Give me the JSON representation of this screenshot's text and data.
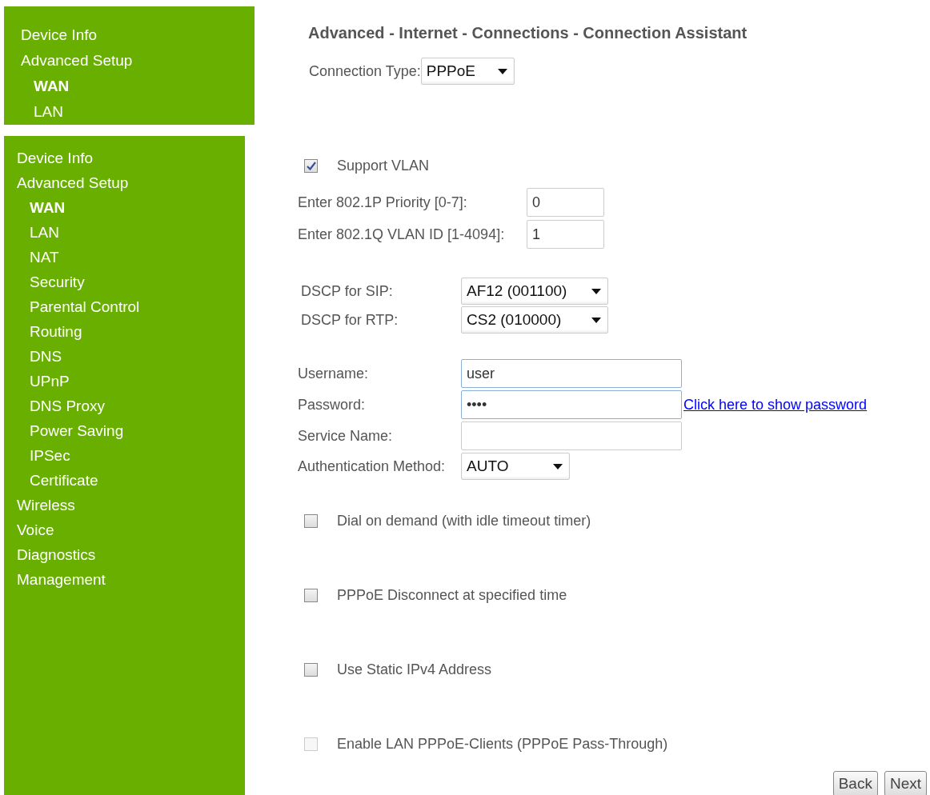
{
  "sidebars": [
    {
      "items": [
        {
          "label": "Device Info",
          "selected": false
        },
        {
          "label": "Advanced Setup",
          "selected": false,
          "children": [
            {
              "label": "WAN",
              "selected": true
            },
            {
              "label": "LAN",
              "selected": false
            }
          ]
        }
      ]
    },
    {
      "items": [
        {
          "label": "Device Info",
          "selected": false
        },
        {
          "label": "Advanced Setup",
          "selected": false,
          "children": [
            {
              "label": "WAN",
              "selected": true
            },
            {
              "label": "LAN",
              "selected": false
            },
            {
              "label": "NAT",
              "selected": false
            },
            {
              "label": "Security",
              "selected": false
            },
            {
              "label": "Parental Control",
              "selected": false
            },
            {
              "label": "Routing",
              "selected": false
            },
            {
              "label": "DNS",
              "selected": false
            },
            {
              "label": "UPnP",
              "selected": false
            },
            {
              "label": "DNS Proxy",
              "selected": false
            },
            {
              "label": "Power Saving",
              "selected": false
            },
            {
              "label": "IPSec",
              "selected": false
            },
            {
              "label": "Certificate",
              "selected": false
            }
          ]
        },
        {
          "label": "Wireless",
          "selected": false
        },
        {
          "label": "Voice",
          "selected": false
        },
        {
          "label": "Diagnostics",
          "selected": false
        },
        {
          "label": "Management",
          "selected": false
        }
      ]
    }
  ],
  "title": "Advanced - Internet - Connections - Connection Assistant",
  "connection_type": {
    "label": "Connection Type:",
    "value": "PPPoE"
  },
  "support_vlan": {
    "label": "Support VLAN",
    "checked": true
  },
  "vlan_fields": [
    {
      "label": "Enter 802.1P Priority [0-7]:",
      "value": "0"
    },
    {
      "label": "Enter 802.1Q VLAN ID [1-4094]:",
      "value": "1"
    }
  ],
  "dscp": [
    {
      "label": "DSCP for SIP:",
      "value": "AF12 (001100)"
    },
    {
      "label": "DSCP for RTP:",
      "value": "CS2 (010000)"
    }
  ],
  "credentials": [
    {
      "label": "Username:",
      "value": "user"
    },
    {
      "label": "Password:",
      "value": "••••",
      "link": "Click here to show password"
    },
    {
      "label": "Service Name:"
    }
  ],
  "auth_method": {
    "label": "Authentication Method:",
    "value": "AUTO"
  },
  "options": [
    {
      "label": "Dial on demand (with idle timeout timer)",
      "checked": false,
      "disabled": false
    },
    {
      "label": "PPPoE Disconnect at specified time",
      "checked": false,
      "disabled": false
    },
    {
      "label": "Use Static IPv4 Address",
      "checked": false,
      "disabled": false
    },
    {
      "label": "Enable LAN PPPoE-Clients (PPPoE Pass-Through)",
      "checked": false,
      "disabled": true
    }
  ],
  "buttons": [
    "Back",
    "Next"
  ]
}
